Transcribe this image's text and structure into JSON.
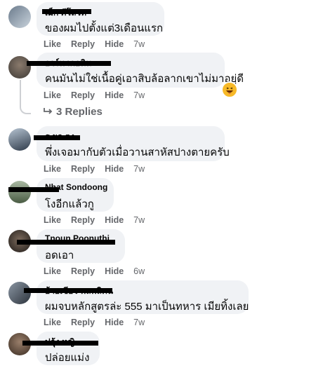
{
  "actions": {
    "like": "Like",
    "reply": "Reply",
    "hide": "Hide"
  },
  "comments": [
    {
      "name": "เม็ก คีโลวท",
      "text": "ของผมไปตั้งแต่3เดือนแรก",
      "time": "7w"
    },
    {
      "name": "อาร์ท เกอนิน",
      "text": "คนมันไม่ใช่เนื้อคู่เอาสิบล้อลากเขาไม่มาอยู่ดี",
      "time": "7w",
      "reaction_icon": "laughing-emoji-icon"
    },
    {
      "name": "ธ ผล ตง",
      "text": "พึ่งเจอมากับตัวเมื่อวานสาหัสปางตายครับ",
      "time": "7w"
    },
    {
      "name": "Nhat Sondoong",
      "text": "โงอีกแล้วกู",
      "time": "7w"
    },
    {
      "name": "Tnoun Poonuthi",
      "text": "อดเอา",
      "time": "6w"
    },
    {
      "name": "อ้ายเชียว พลพลิคน",
      "text": "ผมจบหลักสูตรล่ะ 555 มาเป็นทหาร เมียทิ้งเลย",
      "time": "7w"
    },
    {
      "name": "ปกุ้ง หญิ",
      "text": "ปล่อยแม่ง"
    }
  ],
  "replies_link": {
    "icon": "reply-arrow-icon",
    "label": "3 Replies"
  },
  "colors": {
    "bubble": "#f0f2f5",
    "action_text": "#65676b",
    "text": "#050505"
  }
}
